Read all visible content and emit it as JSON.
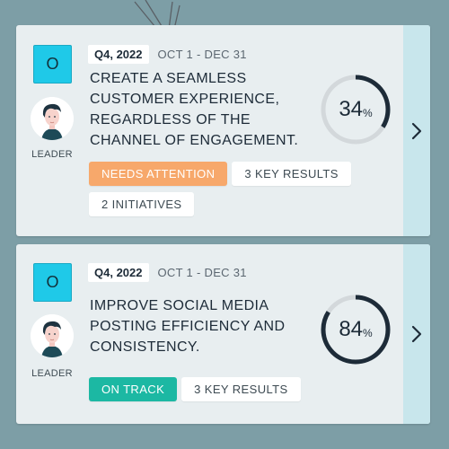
{
  "objectives": [
    {
      "badge": "O",
      "leader_label": "LEADER",
      "quarter": "Q4, 2022",
      "dates": "OCT 1 - DEC 31",
      "title": "CREATE A SEAMLESS CUSTOMER EXPERIENCE, REGARDLESS OF THE CHANNEL OF ENGAGEMENT.",
      "progress": {
        "value": "34",
        "unit": "%",
        "fraction": 0.34
      },
      "tags": [
        {
          "label": "NEEDS ATTENTION",
          "kind": "warn"
        },
        {
          "label": "3 KEY RESULTS",
          "kind": "default"
        },
        {
          "label": "2 INITIATIVES",
          "kind": "default"
        }
      ]
    },
    {
      "badge": "O",
      "leader_label": "LEADER",
      "quarter": "Q4, 2022",
      "dates": "OCT 1 - DEC 31",
      "title": "IMPROVE SOCIAL MEDIA POSTING EFFICIENCY AND CONSISTENCY.",
      "progress": {
        "value": "84",
        "unit": "%",
        "fraction": 0.84
      },
      "tags": [
        {
          "label": "ON TRACK",
          "kind": "ok"
        },
        {
          "label": "3 KEY RESULTS",
          "kind": "default"
        }
      ]
    }
  ],
  "colors": {
    "background": "#7d9ea6",
    "card": "#e8eef0",
    "side_panel": "#c8e6ec",
    "badge": "#1fc9e8",
    "needs_attention": "#f7a86b",
    "on_track": "#1cb8a3",
    "ring_track": "#d3d8db",
    "ring_fill": "#1d2b38"
  },
  "icons": {
    "expand": "chevron-right-icon",
    "avatar": "person-avatar-icon"
  }
}
